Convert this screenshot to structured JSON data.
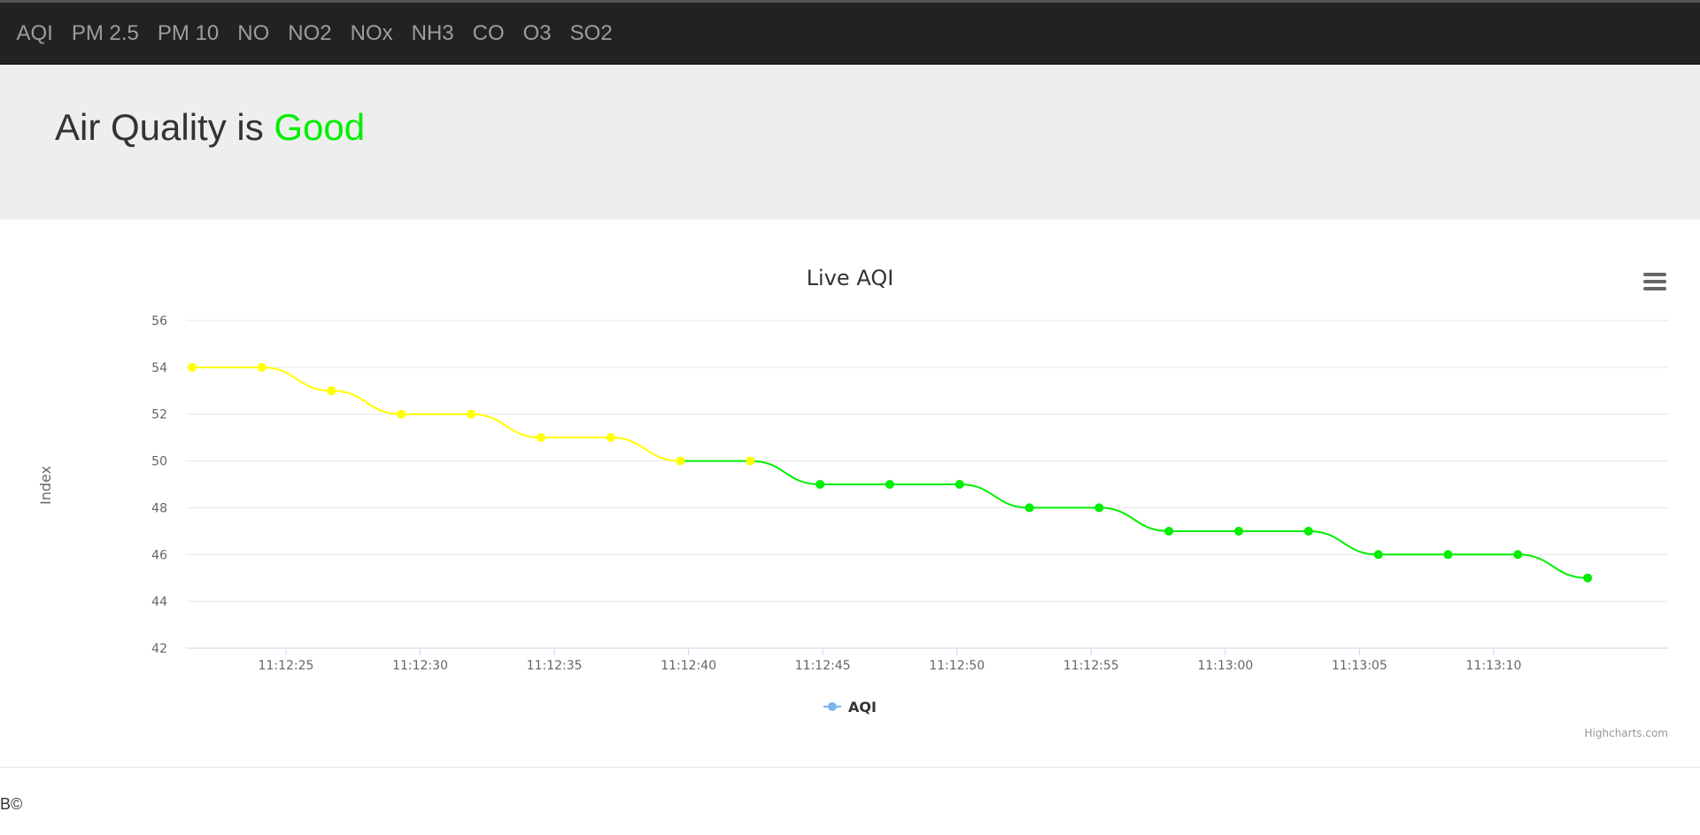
{
  "nav": {
    "items": [
      "AQI",
      "PM 2.5",
      "PM 10",
      "NO",
      "NO2",
      "NOx",
      "NH3",
      "CO",
      "O3",
      "SO2"
    ]
  },
  "banner": {
    "prefix": "Air Quality is ",
    "status": "Good",
    "status_color": "#00ee00"
  },
  "chart_data": {
    "type": "line",
    "title": "Live AQI",
    "xlabel": "",
    "ylabel": "Index",
    "ylim": [
      42,
      56
    ],
    "y_ticks": [
      42,
      44,
      46,
      48,
      50,
      52,
      54,
      56
    ],
    "x_tick_labels": [
      "11:12:25",
      "11:12:30",
      "11:12:35",
      "11:12:40",
      "11:12:45",
      "11:12:50",
      "11:12:55",
      "11:13:00",
      "11:13:05",
      "11:13:10"
    ],
    "series": [
      {
        "name": "AQI",
        "x": [
          "11:12:21.5",
          "11:12:24.1",
          "11:12:26.7",
          "11:12:29.3",
          "11:12:31.9",
          "11:12:34.5",
          "11:12:37.1",
          "11:12:39.7",
          "11:12:42.3",
          "11:12:44.9",
          "11:12:47.5",
          "11:12:50.1",
          "11:12:52.7",
          "11:12:55.3",
          "11:12:57.9",
          "11:13:00.5",
          "11:13:03.1",
          "11:13:05.7",
          "11:13:08.3",
          "11:13:10.9",
          "11:13:13.5"
        ],
        "values": [
          54,
          54,
          53,
          52,
          52,
          51,
          51,
          50,
          50,
          49,
          49,
          49,
          48,
          48,
          47,
          47,
          47,
          46,
          46,
          46,
          45
        ],
        "zones": [
          {
            "above": 50,
            "color": "#ffff00"
          },
          {
            "upto": 50,
            "color": "#00ee00"
          }
        ]
      }
    ],
    "legend": {
      "position": "bottom-center",
      "label": "AQI",
      "marker_color": "#7cb5ec"
    },
    "grid": true,
    "credits": "Highcharts.com"
  },
  "footer": {
    "text": "B©"
  }
}
